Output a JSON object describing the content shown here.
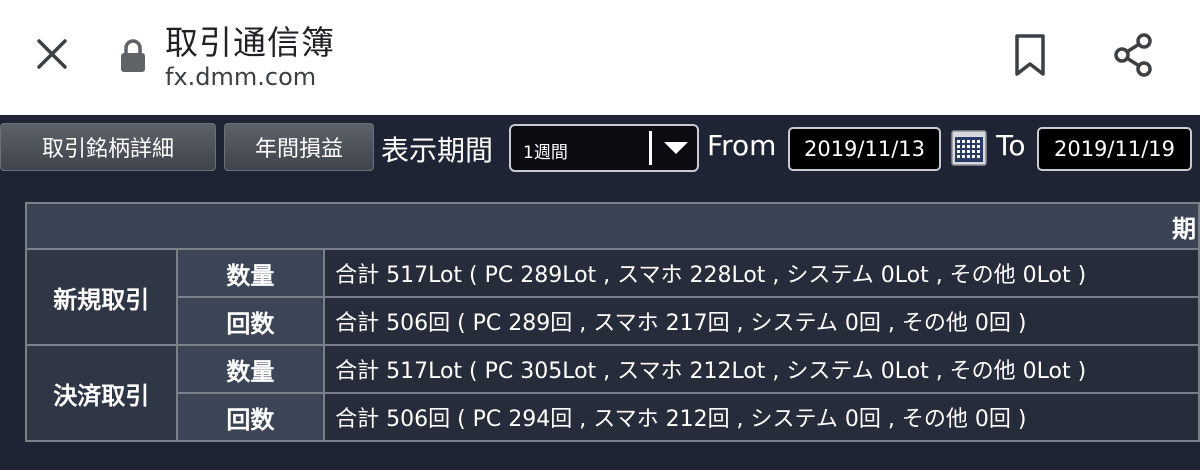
{
  "browser": {
    "title": "取引通信簿",
    "url": "fx.dmm.com",
    "icons": {
      "close": "close-icon",
      "lock": "lock-icon",
      "bookmark": "bookmark-icon",
      "share": "share-icon"
    }
  },
  "toolbar": {
    "detail_button": "取引銘柄詳細",
    "annual_button": "年間損益",
    "period_label": "表示期間",
    "period_selected": "1週間",
    "from_label": "From",
    "from_date": "2019/11/13",
    "calendar_icon": "calendar-icon",
    "to_label": "To",
    "to_date": "2019/11/19"
  },
  "table": {
    "header_partial": "期",
    "groups": [
      {
        "label": "新規取引",
        "rows": [
          {
            "label": "数量",
            "value": "合計 517Lot ( PC 289Lot , スマホ 228Lot , システム 0Lot , その他 0Lot )"
          },
          {
            "label": "回数",
            "value": "合計 506回 ( PC 289回 , スマホ 217回 , システム 0回 , その他 0回 )"
          }
        ]
      },
      {
        "label": "決済取引",
        "rows": [
          {
            "label": "数量",
            "value": "合計 517Lot ( PC 305Lot , スマホ 212Lot , システム 0Lot , その他 0Lot )"
          },
          {
            "label": "回数",
            "value": "合計 506回 ( PC 294回 , スマホ 212回 , システム 0回 , その他 0回 )"
          }
        ]
      }
    ]
  },
  "colors": {
    "app_background": "#1e2433",
    "browser_bar": "#ffffff",
    "table_border": "#7a7f88"
  }
}
